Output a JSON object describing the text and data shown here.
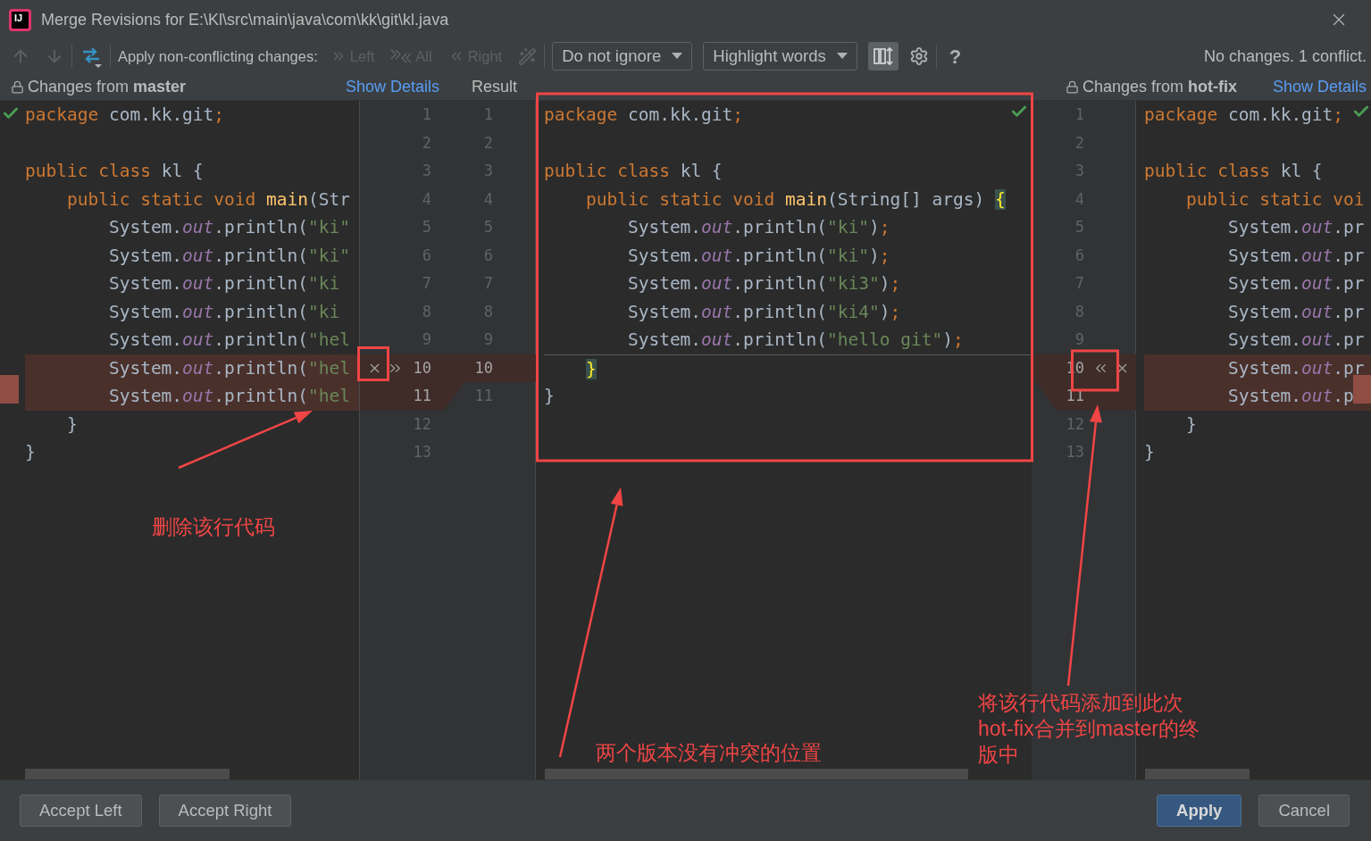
{
  "window": {
    "logo_text": "IJ",
    "title": "Merge Revisions for E:\\Kl\\src\\main\\java\\com\\kk\\git\\kl.java"
  },
  "toolbar": {
    "prev_diff": {
      "disabled": true
    },
    "next_diff": {
      "disabled": true
    },
    "apply_label": "Apply non-conflicting changes:",
    "apply_actions": [
      {
        "kind": "left",
        "label": "Left",
        "disabled": true
      },
      {
        "kind": "all",
        "label": "All",
        "disabled": true
      },
      {
        "kind": "right",
        "label": "Right",
        "disabled": true
      }
    ],
    "magic_resolve": {
      "disabled": true
    },
    "dropdowns": [
      {
        "value": "Do not ignore"
      },
      {
        "value": "Highlight words"
      }
    ],
    "sync_scroll": {
      "selected": true
    },
    "help": "?",
    "status": "No changes. 1 conflict."
  },
  "left_panel": {
    "header": "Changes from **master**",
    "link": "Show Details",
    "gutter_actions": [
      {
        "kind": "ignore"
      },
      {
        "kind": "apply"
      }
    ],
    "lines": [
      {
        "number": "1",
        "conflict": false,
        "tokens": [
          {
            "kind": "kw",
            "text": "package"
          },
          {
            "kind": "plain",
            "text": " com.kk.git"
          },
          {
            "kind": "kw",
            "text": ";"
          }
        ]
      },
      {
        "number": "2",
        "conflict": false
      },
      {
        "number": "3",
        "conflict": false,
        "tokens": [
          {
            "kind": "kw",
            "text": "public class"
          },
          {
            "kind": "plain",
            "text": " kl {"
          }
        ]
      },
      {
        "number": "4",
        "conflict": false,
        "tokens": [
          {
            "kind": "kw",
            "text": "    public static void"
          },
          {
            "kind": "method",
            "text": " main"
          },
          {
            "kind": "plain",
            "text": "(Str"
          }
        ]
      },
      {
        "number": "5",
        "conflict": false,
        "tokens": [
          {
            "kind": "plain",
            "text": "        System."
          },
          {
            "kind": "field",
            "text": "out"
          },
          {
            "kind": "plain",
            "text": ".println("
          },
          {
            "kind": "str",
            "text": "\"ki\""
          }
        ]
      },
      {
        "number": "6",
        "conflict": false,
        "tokens": [
          {
            "kind": "plain",
            "text": "        System."
          },
          {
            "kind": "field",
            "text": "out"
          },
          {
            "kind": "plain",
            "text": ".println("
          },
          {
            "kind": "str",
            "text": "\"ki\""
          }
        ]
      },
      {
        "number": "7",
        "conflict": false,
        "tokens": [
          {
            "kind": "plain",
            "text": "        System."
          },
          {
            "kind": "field",
            "text": "out"
          },
          {
            "kind": "plain",
            "text": ".println("
          },
          {
            "kind": "str",
            "text": "\"ki"
          }
        ]
      },
      {
        "number": "8",
        "conflict": false,
        "tokens": [
          {
            "kind": "plain",
            "text": "        System."
          },
          {
            "kind": "field",
            "text": "out"
          },
          {
            "kind": "plain",
            "text": ".println("
          },
          {
            "kind": "str",
            "text": "\"ki"
          }
        ]
      },
      {
        "number": "9",
        "conflict": false,
        "tokens": [
          {
            "kind": "plain",
            "text": "        System."
          },
          {
            "kind": "field",
            "text": "out"
          },
          {
            "kind": "plain",
            "text": ".println("
          },
          {
            "kind": "str",
            "text": "\"hel"
          }
        ]
      },
      {
        "number": "10",
        "conflict": true,
        "tokens": [
          {
            "kind": "plain",
            "text": "        System."
          },
          {
            "kind": "field",
            "text": "out"
          },
          {
            "kind": "plain",
            "text": ".println("
          },
          {
            "kind": "str",
            "text": "\"hel"
          }
        ]
      },
      {
        "number": "11",
        "conflict": true,
        "tokens": [
          {
            "kind": "plain",
            "text": "        System."
          },
          {
            "kind": "field",
            "text": "out"
          },
          {
            "kind": "plain",
            "text": ".println("
          },
          {
            "kind": "str",
            "text": "\"hel"
          }
        ]
      },
      {
        "number": "12",
        "conflict": false,
        "tokens": [
          {
            "kind": "plain",
            "text": "    }"
          }
        ]
      },
      {
        "number": "13",
        "conflict": false,
        "tokens": [
          {
            "kind": "plain",
            "text": "}"
          }
        ]
      }
    ]
  },
  "result_panel": {
    "header": "Result",
    "lines": [
      {
        "number": "1",
        "conflict": false,
        "tokens": [
          {
            "kind": "kw",
            "text": "package"
          },
          {
            "kind": "plain",
            "text": " com.kk.git"
          },
          {
            "kind": "kw",
            "text": ";"
          }
        ]
      },
      {
        "number": "2",
        "conflict": false
      },
      {
        "number": "3",
        "conflict": false,
        "tokens": [
          {
            "kind": "kw",
            "text": "public class"
          },
          {
            "kind": "plain",
            "text": " kl {"
          }
        ]
      },
      {
        "number": "4",
        "conflict": false,
        "tokens": [
          {
            "kind": "kw",
            "text": "    public static void"
          },
          {
            "kind": "method",
            "text": " main"
          },
          {
            "kind": "plain",
            "text": "(String[] args)"
          },
          {
            "kind": "brace",
            "text": " {"
          }
        ]
      },
      {
        "number": "5",
        "conflict": false,
        "tokens": [
          {
            "kind": "plain",
            "text": "        System."
          },
          {
            "kind": "field",
            "text": "out"
          },
          {
            "kind": "plain",
            "text": ".println("
          },
          {
            "kind": "str",
            "text": "\"ki\""
          },
          {
            "kind": "plain",
            "text": ")"
          },
          {
            "kind": "kw",
            "text": ";"
          }
        ]
      },
      {
        "number": "6",
        "conflict": false,
        "tokens": [
          {
            "kind": "plain",
            "text": "        System."
          },
          {
            "kind": "field",
            "text": "out"
          },
          {
            "kind": "plain",
            "text": ".println("
          },
          {
            "kind": "str",
            "text": "\"ki\""
          },
          {
            "kind": "plain",
            "text": ")"
          },
          {
            "kind": "kw",
            "text": ";"
          }
        ]
      },
      {
        "number": "7",
        "conflict": false,
        "tokens": [
          {
            "kind": "plain",
            "text": "        System."
          },
          {
            "kind": "field",
            "text": "out"
          },
          {
            "kind": "plain",
            "text": ".println("
          },
          {
            "kind": "str",
            "text": "\"ki3\""
          },
          {
            "kind": "plain",
            "text": ")"
          },
          {
            "kind": "kw",
            "text": ";"
          }
        ]
      },
      {
        "number": "8",
        "conflict": false,
        "tokens": [
          {
            "kind": "plain",
            "text": "        System."
          },
          {
            "kind": "field",
            "text": "out"
          },
          {
            "kind": "plain",
            "text": ".println("
          },
          {
            "kind": "str",
            "text": "\"ki4\""
          },
          {
            "kind": "plain",
            "text": ")"
          },
          {
            "kind": "kw",
            "text": ";"
          }
        ]
      },
      {
        "number": "9",
        "conflict": false,
        "tokens": [
          {
            "kind": "plain",
            "text": "        System."
          },
          {
            "kind": "field",
            "text": "out"
          },
          {
            "kind": "plain",
            "text": ".println("
          },
          {
            "kind": "str",
            "text": "\"hello git\""
          },
          {
            "kind": "plain",
            "text": ")"
          },
          {
            "kind": "kw",
            "text": ";"
          }
        ]
      },
      {
        "number": "10",
        "conflict": true,
        "tokens": [
          {
            "kind": "brace",
            "text": "    }"
          }
        ]
      },
      {
        "number": "11",
        "conflict": false,
        "tokens": [
          {
            "kind": "plain",
            "text": "}"
          }
        ]
      }
    ]
  },
  "right_panel": {
    "header": "Changes from **hot-fix**",
    "link": "Show Details",
    "gutter_actions": [
      {
        "kind": "apply"
      },
      {
        "kind": "ignore"
      }
    ],
    "lines": [
      {
        "number": "1",
        "conflict": false,
        "tokens": [
          {
            "kind": "kw",
            "text": "package"
          },
          {
            "kind": "plain",
            "text": " com.kk.git"
          },
          {
            "kind": "kw",
            "text": ";"
          }
        ]
      },
      {
        "number": "2",
        "conflict": false
      },
      {
        "number": "3",
        "conflict": false,
        "tokens": [
          {
            "kind": "kw",
            "text": "public class"
          },
          {
            "kind": "plain",
            "text": " kl {"
          }
        ]
      },
      {
        "number": "4",
        "conflict": false,
        "tokens": [
          {
            "kind": "kw",
            "text": "    public static voi"
          }
        ]
      },
      {
        "number": "5",
        "conflict": false,
        "tokens": [
          {
            "kind": "plain",
            "text": "        System."
          },
          {
            "kind": "field",
            "text": "out"
          },
          {
            "kind": "plain",
            "text": ".pr"
          }
        ]
      },
      {
        "number": "6",
        "conflict": false,
        "tokens": [
          {
            "kind": "plain",
            "text": "        System."
          },
          {
            "kind": "field",
            "text": "out"
          },
          {
            "kind": "plain",
            "text": ".pr"
          }
        ]
      },
      {
        "number": "7",
        "conflict": false,
        "tokens": [
          {
            "kind": "plain",
            "text": "        System."
          },
          {
            "kind": "field",
            "text": "out"
          },
          {
            "kind": "plain",
            "text": ".pr"
          }
        ]
      },
      {
        "number": "8",
        "conflict": false,
        "tokens": [
          {
            "kind": "plain",
            "text": "        System."
          },
          {
            "kind": "field",
            "text": "out"
          },
          {
            "kind": "plain",
            "text": ".pr"
          }
        ]
      },
      {
        "number": "9",
        "conflict": false,
        "tokens": [
          {
            "kind": "plain",
            "text": "        System."
          },
          {
            "kind": "field",
            "text": "out"
          },
          {
            "kind": "plain",
            "text": ".pr"
          }
        ]
      },
      {
        "number": "10",
        "conflict": true,
        "tokens": [
          {
            "kind": "plain",
            "text": "        System."
          },
          {
            "kind": "field",
            "text": "out"
          },
          {
            "kind": "plain",
            "text": ".pr"
          }
        ]
      },
      {
        "number": "11",
        "conflict": true,
        "tokens": [
          {
            "kind": "plain",
            "text": "        System."
          },
          {
            "kind": "field",
            "text": "out"
          },
          {
            "kind": "plain",
            "text": ".p"
          }
        ]
      },
      {
        "number": "12",
        "conflict": false,
        "tokens": [
          {
            "kind": "plain",
            "text": "    }"
          }
        ]
      },
      {
        "number": "13",
        "conflict": false,
        "tokens": [
          {
            "kind": "plain",
            "text": "}"
          }
        ]
      }
    ]
  },
  "annotations": [
    "删除该行代码",
    "两个版本没有冲突的位置",
    "将该行代码添加到此次hot-fix合并到master的终版中"
  ],
  "left_buttons": [
    {
      "label": "Accept Left",
      "kind": "secondary"
    },
    {
      "label": "Accept Right",
      "kind": "secondary"
    }
  ],
  "right_buttons": [
    {
      "label": "Apply",
      "kind": "primary"
    },
    {
      "label": "Cancel",
      "kind": "secondary"
    }
  ]
}
